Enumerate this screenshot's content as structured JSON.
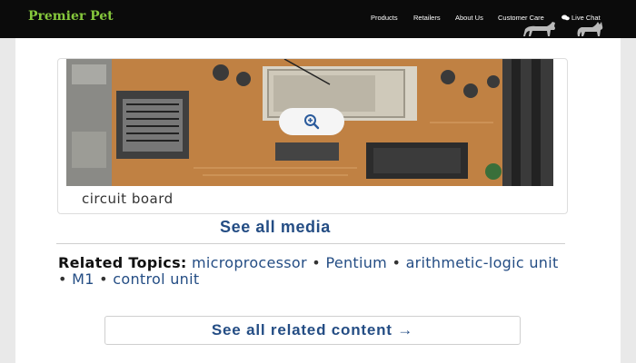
{
  "brand": {
    "name": "Premier Pet",
    "accent": "#86c83c"
  },
  "nav": {
    "products": "Products",
    "retailers": "Retailers",
    "about": "About Us",
    "care": "Customer Care",
    "chat": "Live Chat",
    "chat_icon": "chat-bubbles-icon"
  },
  "media": {
    "caption": "circuit board",
    "zoom_icon": "magnifier-plus-icon",
    "see_all_label": "See all media"
  },
  "related": {
    "lead": "Related Topics:",
    "topics": [
      "microprocessor",
      "Pentium",
      "arithmetic-logic unit",
      "M1",
      "control unit"
    ],
    "separator": "•",
    "see_all_label": "See all related content →"
  },
  "colors": {
    "link": "#244d84",
    "topbar": "#0b0b0b"
  }
}
